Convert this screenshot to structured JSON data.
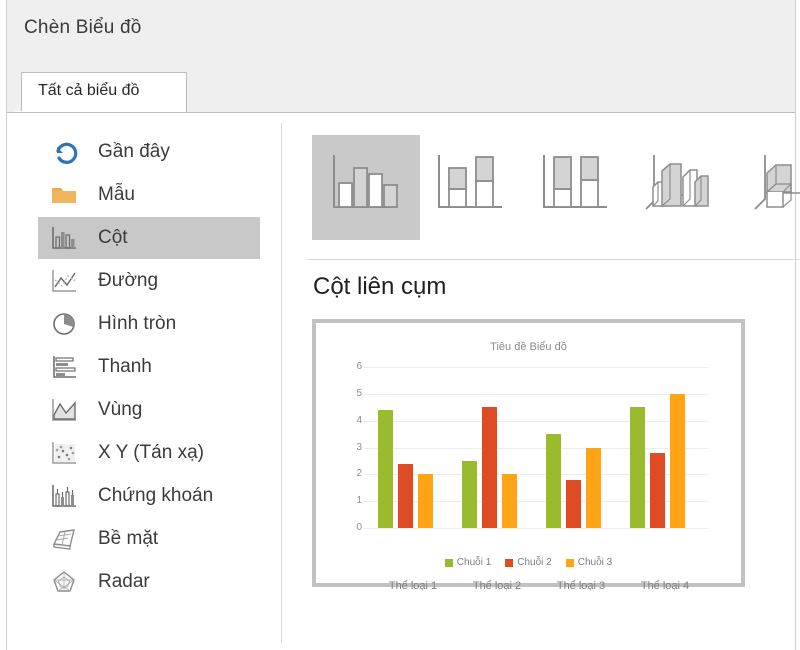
{
  "window": {
    "title": "Chèn Biểu đồ"
  },
  "tabs": [
    {
      "label": "Tất cả biểu đồ",
      "selected": true
    }
  ],
  "sidebar": {
    "items": [
      {
        "label": "Gần đây",
        "icon": "recent-undo-arrow-icon",
        "selected": false
      },
      {
        "label": "Mẫu",
        "icon": "folder-icon",
        "selected": false
      },
      {
        "label": "Cột",
        "icon": "column-chart-icon",
        "selected": true
      },
      {
        "label": "Đường",
        "icon": "line-chart-icon",
        "selected": false
      },
      {
        "label": "Hình tròn",
        "icon": "pie-chart-icon",
        "selected": false
      },
      {
        "label": "Thanh",
        "icon": "bar-chart-icon",
        "selected": false
      },
      {
        "label": "Vùng",
        "icon": "area-chart-icon",
        "selected": false
      },
      {
        "label": "X Y (Tán xạ)",
        "icon": "scatter-chart-icon",
        "selected": false
      },
      {
        "label": "Chứng khoán",
        "icon": "stock-chart-icon",
        "selected": false
      },
      {
        "label": "Bề mặt",
        "icon": "surface-chart-icon",
        "selected": false
      },
      {
        "label": "Radar",
        "icon": "radar-chart-icon",
        "selected": false
      }
    ]
  },
  "thumbnails": [
    {
      "name": "clustered-column",
      "icon": "clustered-column-icon",
      "selected": true
    },
    {
      "name": "stacked-column",
      "icon": "stacked-column-icon",
      "selected": false
    },
    {
      "name": "100-percent-stacked-column",
      "icon": "percent-stacked-column-icon",
      "selected": false
    },
    {
      "name": "3d-clustered-column",
      "icon": "three-d-clustered-column-icon",
      "selected": false
    },
    {
      "name": "3d-column",
      "icon": "three-d-column-icon",
      "selected": false
    }
  ],
  "preview": {
    "heading": "Cột liên cụm"
  },
  "colors": {
    "series1": "#9BBB2E",
    "series2": "#DE4C24",
    "series3": "#FFA415",
    "selection": "#C8C8C8",
    "titlebar": "#EFEFF0",
    "border": "#BCBCBC"
  },
  "chart_data": {
    "type": "bar",
    "title": "Tiêu đề Biểu đồ",
    "xlabel": "",
    "ylabel": "",
    "categories": [
      "Thể loại 1",
      "Thể loại 2",
      "Thể loại 3",
      "Thể loại 4"
    ],
    "series": [
      {
        "name": "Chuỗi 1",
        "color": "#9BBB2E",
        "values": [
          4.4,
          2.5,
          3.5,
          4.5
        ]
      },
      {
        "name": "Chuỗi 2",
        "color": "#DE4C24",
        "values": [
          2.4,
          4.5,
          1.8,
          2.8
        ]
      },
      {
        "name": "Chuỗi 3",
        "color": "#FFA415",
        "values": [
          2.0,
          2.0,
          3.0,
          5.0
        ]
      }
    ],
    "ylim": [
      0,
      6
    ],
    "yticks": [
      0,
      1,
      2,
      3,
      4,
      5,
      6
    ],
    "grid": true,
    "legend": "bottom"
  }
}
